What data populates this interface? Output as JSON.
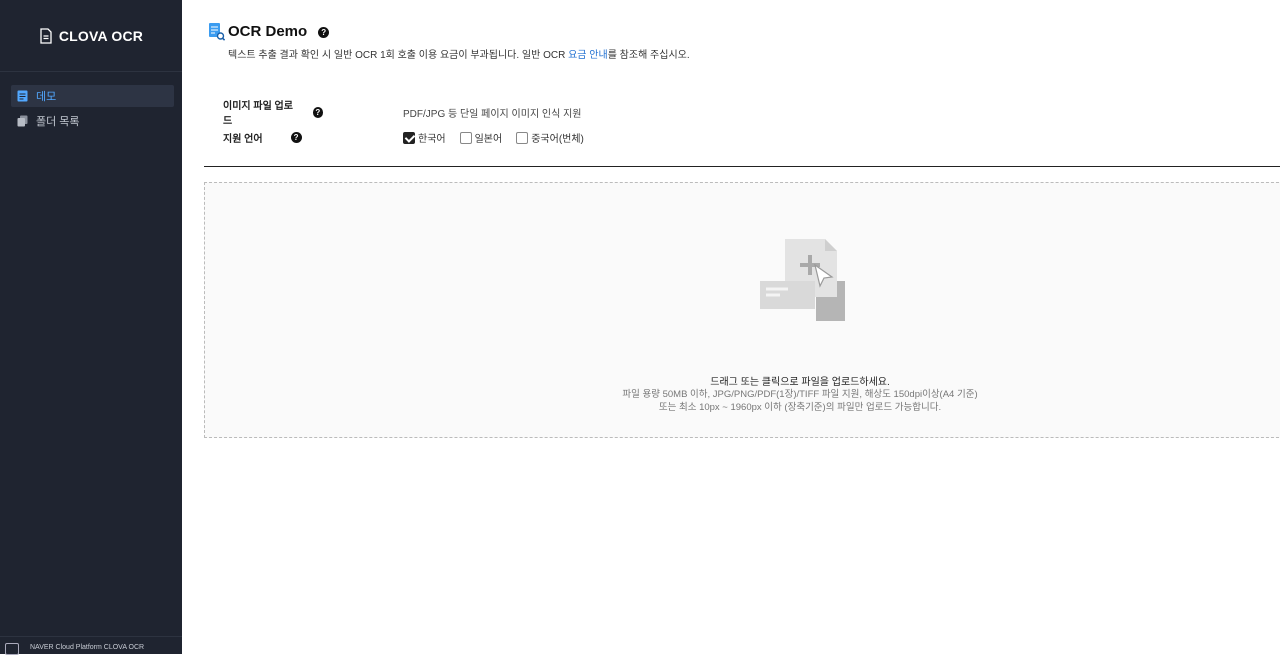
{
  "app": {
    "brand": "CLOVA OCR"
  },
  "sidebar": {
    "items": [
      {
        "label": "데모",
        "icon": "document-icon",
        "active": true
      },
      {
        "label": "폴더 목록",
        "icon": "folders-icon",
        "active": false
      }
    ],
    "footer": "NAVER Cloud Platform CLOVA OCR"
  },
  "page": {
    "title": "OCR Demo",
    "subtitle_before": "텍스트 추출 결과 확인 시 일반 OCR 1회 호출 이용 요금이 부과됩니다. 일반 OCR ",
    "subtitle_link": "요금 안내",
    "subtitle_after": "를 참조해 주십시오."
  },
  "upload": {
    "label": "이미지 파일 업로드",
    "description": "PDF/JPG 등 단일 페이지 이미지 인식 지원"
  },
  "language": {
    "label": "지원 언어",
    "options": [
      {
        "label": "한국어",
        "checked": true
      },
      {
        "label": "일본어",
        "checked": false
      },
      {
        "label": "중국어(번체)",
        "checked": false
      }
    ]
  },
  "dropzone": {
    "main": "드래그 또는 클릭으로 파일을 업로드하세요.",
    "line1": "파일 용량 50MB 이하, JPG/PNG/PDF(1장)/TIFF 파일 지원, 해상도 150dpi이상(A4 기준)",
    "line2": "또는 최소 10px ~ 1960px 이하 (장축기준)의 파일만 업로드 가능합니다."
  },
  "colors": {
    "sidebar_bg": "#1f2430",
    "accent": "#52a8ff",
    "link": "#1f6fd1"
  }
}
